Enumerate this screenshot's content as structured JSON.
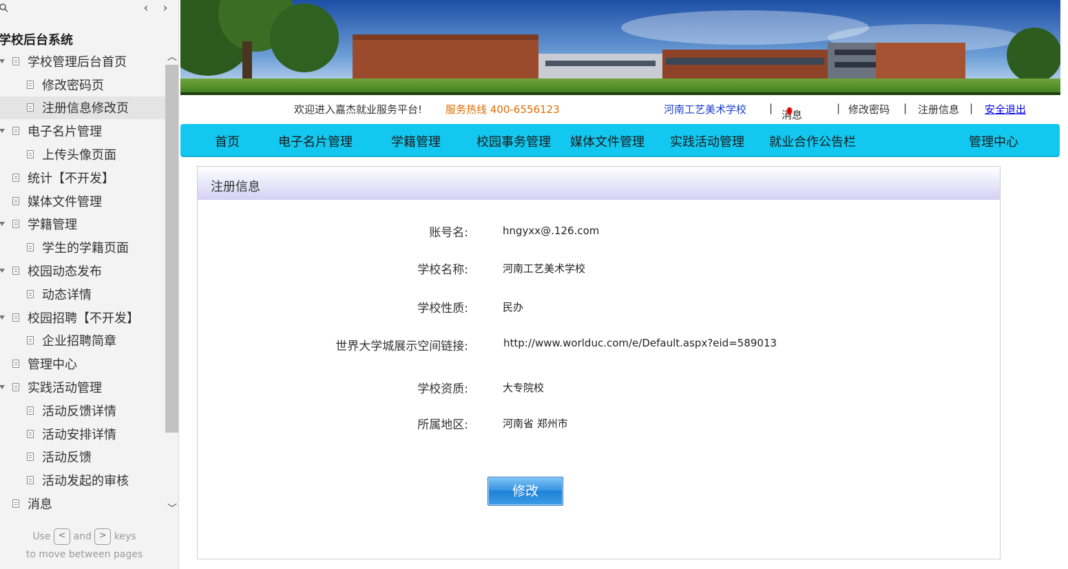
{
  "sidebar": {
    "title": "学校后台系统",
    "items": [
      {
        "label": "学校管理后台首页"
      },
      {
        "label": "修改密码页"
      },
      {
        "label": "注册信息修改页"
      },
      {
        "label": "电子名片管理"
      },
      {
        "label": "上传头像页面"
      },
      {
        "label": "统计【不开发】"
      },
      {
        "label": "媒体文件管理"
      },
      {
        "label": "学籍管理"
      },
      {
        "label": "学生的学籍页面"
      },
      {
        "label": "校园动态发布"
      },
      {
        "label": "动态详情"
      },
      {
        "label": "校园招聘【不开发】"
      },
      {
        "label": "企业招聘简章"
      },
      {
        "label": "管理中心"
      },
      {
        "label": "实践活动管理"
      },
      {
        "label": "活动反馈详情"
      },
      {
        "label": "活动安排详情"
      },
      {
        "label": "活动反馈"
      },
      {
        "label": "活动发起的审核"
      },
      {
        "label": "消息"
      }
    ],
    "hint": {
      "use": "Use",
      "and": "and",
      "keys": "keys",
      "line2": "to move between pages",
      "key_prev": "<",
      "key_next": ">"
    }
  },
  "userbar": {
    "welcome": "欢迎进入嘉杰就业服务平台!",
    "hotline": "服务热线  400-6556123",
    "school": "河南工艺美术学校",
    "sep": "|",
    "messages": "消息",
    "change_password": "修改密码",
    "register_info": "注册信息",
    "logout": "安全退出"
  },
  "nav": {
    "home": "首页",
    "cards": "电子名片管理",
    "status": "学籍管理",
    "affairs": "校园事务管理",
    "media": "媒体文件管理",
    "practice": "实践活动管理",
    "cooperation": "就业合作公告栏",
    "admin": "管理中心"
  },
  "panel": {
    "title": "注册信息",
    "rows": [
      {
        "label": "账号名:",
        "value": "hngyxx@.126.com"
      },
      {
        "label": "学校名称:",
        "value": "河南工艺美术学校"
      },
      {
        "label": "学校性质:",
        "value": "民办"
      },
      {
        "label": "世界大学城展示空间链接:",
        "value": "http://www.worlduc.com/e/Default.aspx?eid=589013"
      },
      {
        "label": "学校资质:",
        "value": "大专院校"
      },
      {
        "label": "所属地区:",
        "value": "河南省  郑州市"
      }
    ],
    "edit_label": "修改"
  },
  "colors": {
    "nav_bg": "#12c8f0",
    "hotline": "#e06a00",
    "button": "#1e82d8"
  }
}
